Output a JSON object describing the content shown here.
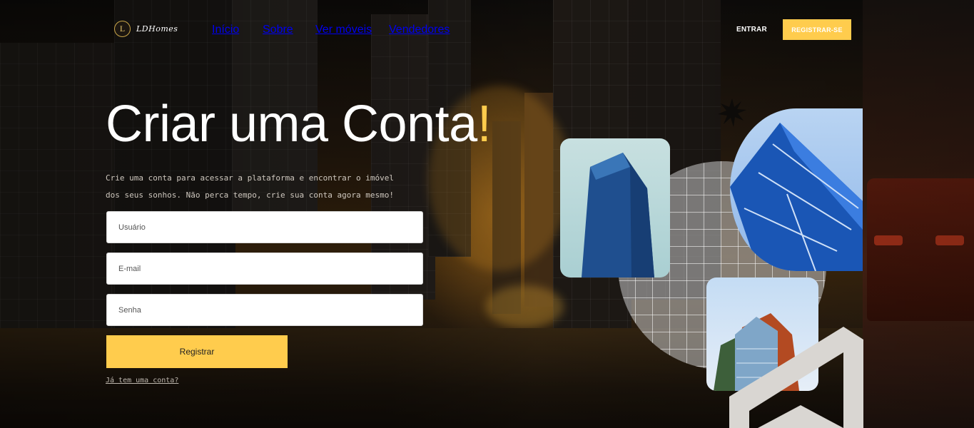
{
  "brand": {
    "badge": "L",
    "name": "LDHomes"
  },
  "nav": {
    "items": [
      {
        "label": "Início"
      },
      {
        "label": "Sobre"
      },
      {
        "label": "Ver móveis"
      },
      {
        "label": "Vendedores"
      }
    ],
    "login": "ENTRAR",
    "register": "REGISTRAR-SE"
  },
  "hero": {
    "title": "Criar uma Conta",
    "title_mark": "!",
    "subtitle": "Crie uma conta para acessar a plataforma e encontrar o imóvel dos seus sonhos. Não perca tempo, crie sua conta agora mesmo!"
  },
  "form": {
    "username_placeholder": "Usuário",
    "email_placeholder": "E-mail",
    "password_placeholder": "Senha",
    "submit": "Registrar",
    "login_link": "Já tem uma conta?"
  },
  "colors": {
    "accent": "#ffcc4d",
    "text": "#ffffff"
  },
  "icons": {
    "badge": "logo-badge-icon",
    "star": "starburst-icon",
    "house": "house-outline-icon"
  }
}
